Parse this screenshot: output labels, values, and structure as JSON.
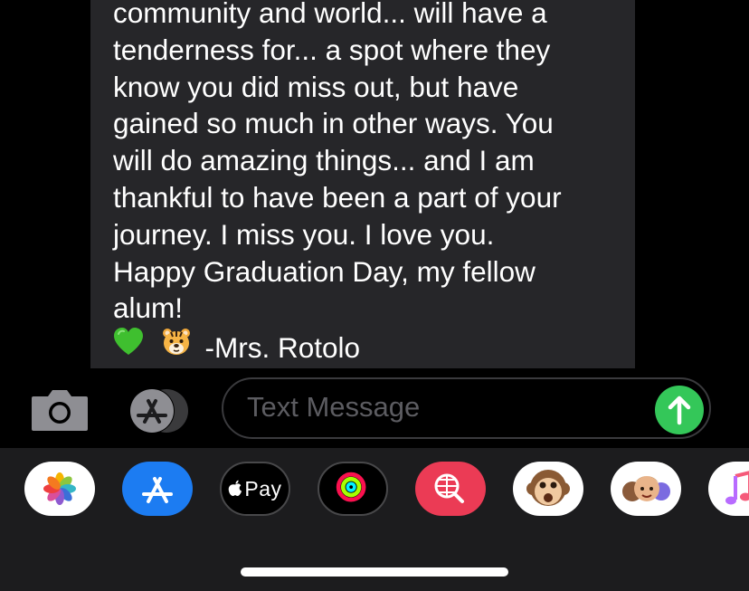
{
  "message": {
    "lines": [
      "community and world... will have a",
      "tenderness for... a spot where they",
      "know you did miss out, but have",
      "gained so much in other ways. You",
      "will do amazing things... and I am",
      "thankful to have been a part of your",
      "journey. I miss you. I love you.",
      "Happy Graduation Day, my fellow",
      "alum!"
    ],
    "signature": "-Mrs. Rotolo",
    "emojis": [
      "green-heart",
      "tiger-face"
    ]
  },
  "input": {
    "placeholder": "Text Message"
  },
  "app_drawer": {
    "items": [
      "Photos",
      "App Store",
      "Apple Pay",
      "Activity",
      "Search Images",
      "Animoji",
      "Memoji",
      "Music"
    ],
    "apple_pay_label": "Pay"
  },
  "colors": {
    "bubble": "#262629",
    "send": "#34c759",
    "app_store_blue": "#1c7cf2",
    "search_red": "#eb3b55",
    "drawer_bg": "#1c1c1e"
  }
}
